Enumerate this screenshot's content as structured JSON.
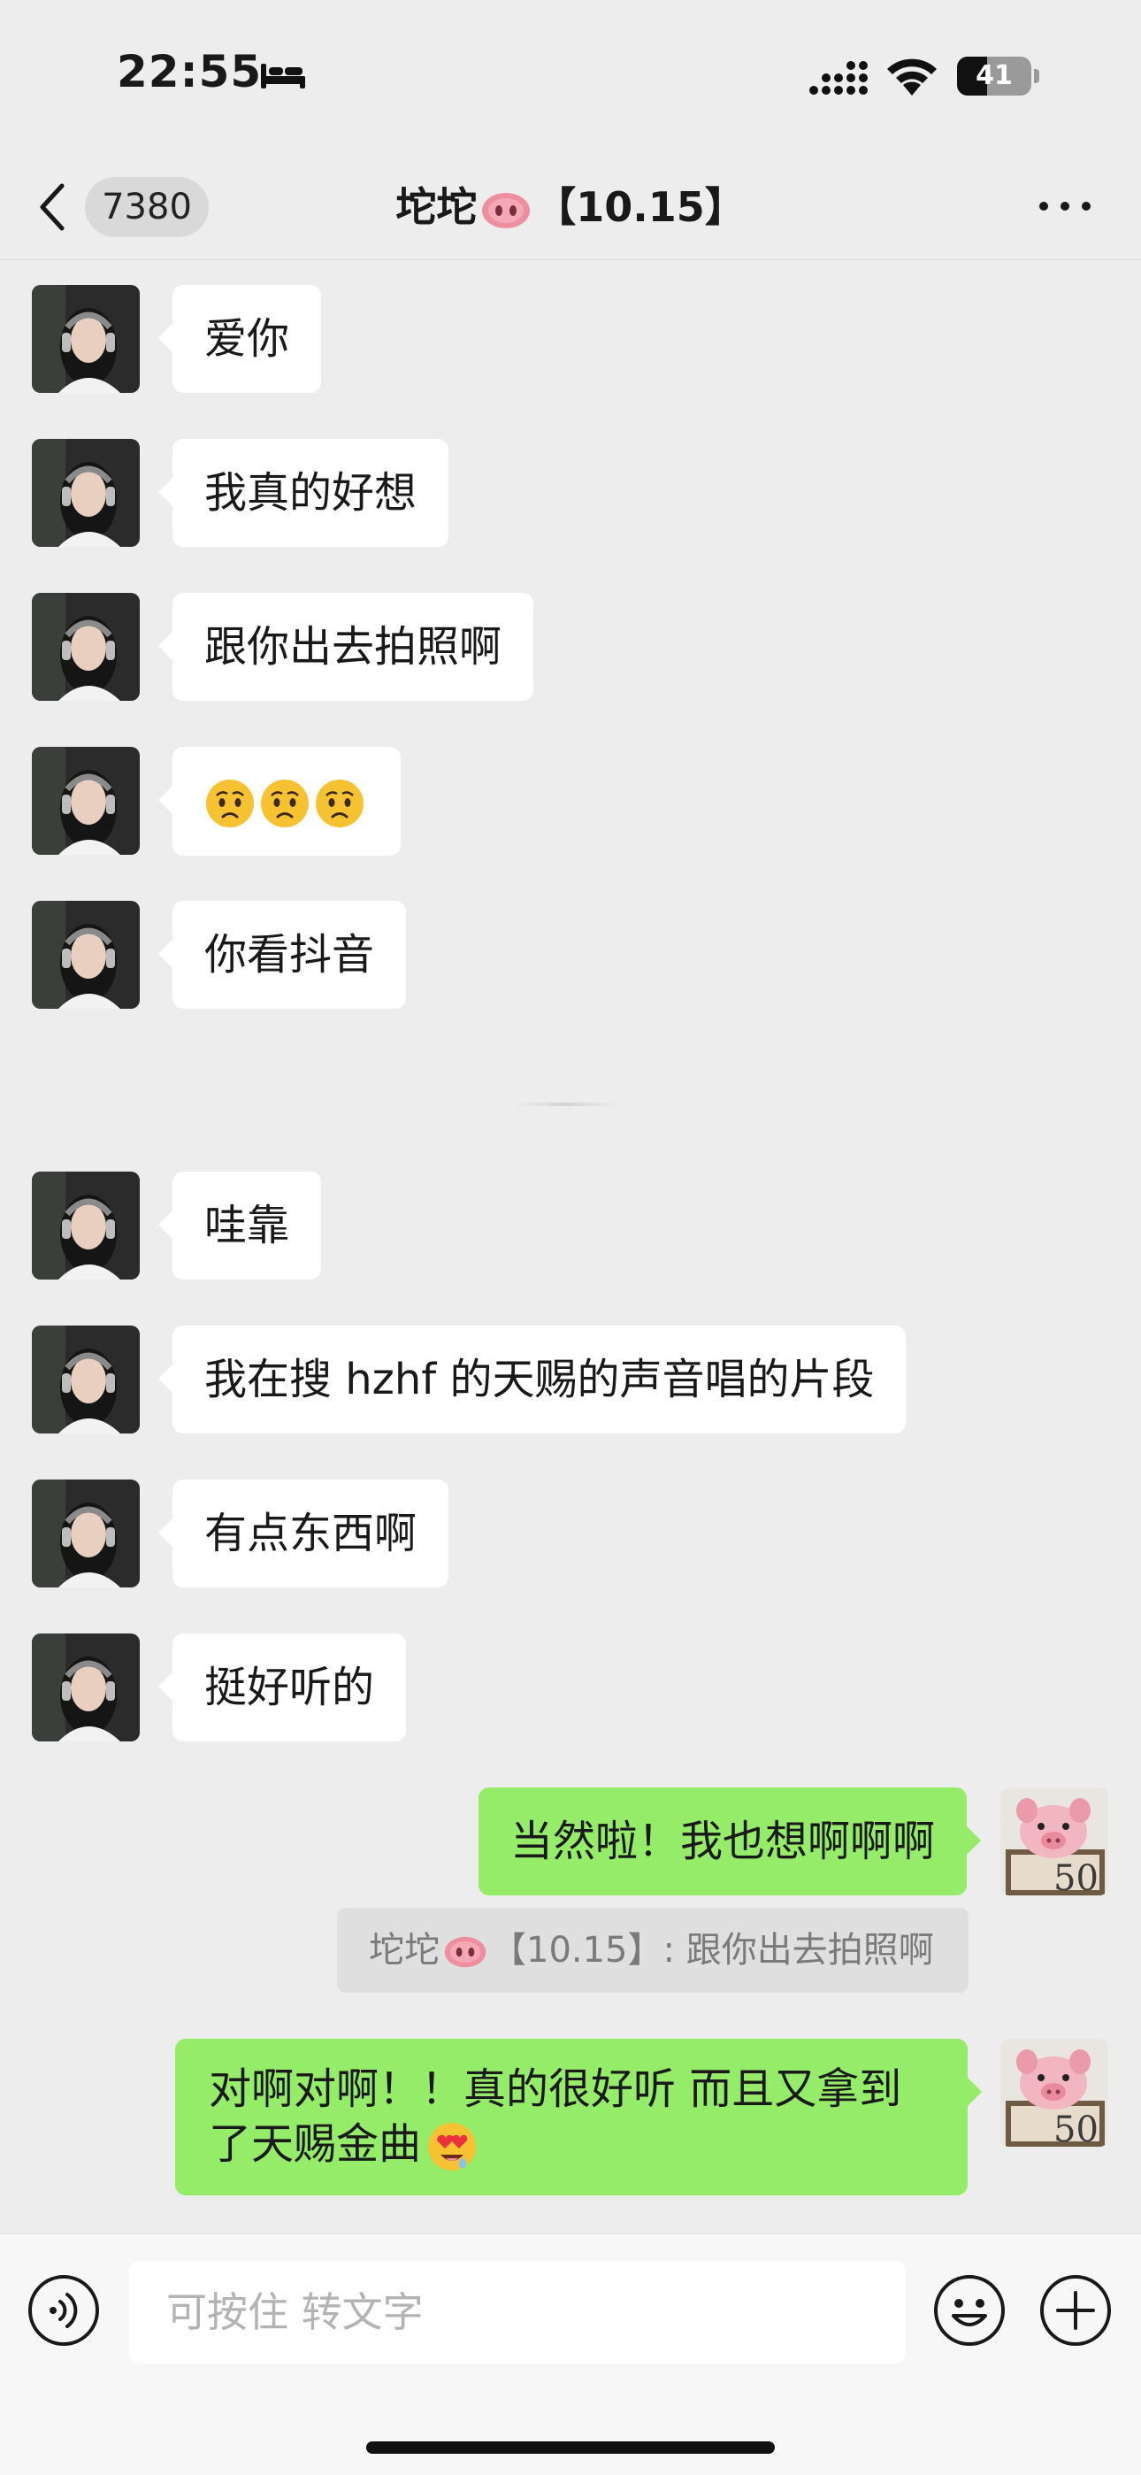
{
  "status_bar": {
    "time": "22:55",
    "battery": "41",
    "battery_level": 0.41
  },
  "nav": {
    "back_count": "7380",
    "title_prefix": "坨坨",
    "title_suffix": "【10.15】"
  },
  "messages_incoming_1": [
    {
      "text": "爱你"
    },
    {
      "text": "我真的好想"
    },
    {
      "text": "跟你出去拍照啊"
    },
    {
      "text": "",
      "emoji": [
        "frowning-face",
        "frowning-face",
        "frowning-face"
      ]
    },
    {
      "text": "你看抖音"
    }
  ],
  "messages_incoming_2": [
    {
      "text": "哇靠"
    },
    {
      "text": "我在搜 hzhf 的天赐的声音唱的片段"
    },
    {
      "text": "有点东西啊"
    },
    {
      "text": "挺好听的"
    }
  ],
  "outgoing": [
    {
      "text": "当然啦！我也想啊啊啊"
    },
    {
      "text": "对啊对啊！！真的很好听 而且又拿到了天赐金曲",
      "emoji": "heart-eyes"
    }
  ],
  "quote": {
    "name": "坨坨",
    "suffix": "【10.15】: 跟你出去拍照啊"
  },
  "input": {
    "placeholder": "可按住 转文字"
  },
  "colors": {
    "outgoing_bubble": "#95ec69",
    "incoming_bubble": "#ffffff",
    "background": "#ededed"
  }
}
